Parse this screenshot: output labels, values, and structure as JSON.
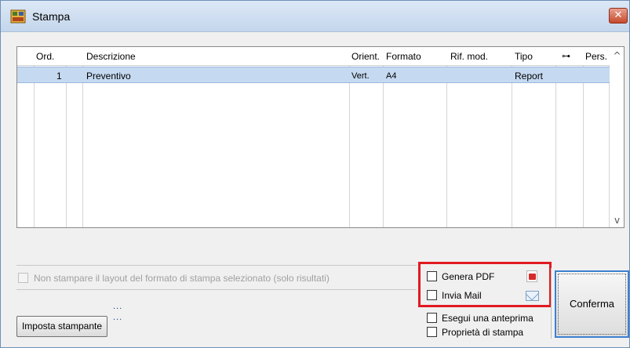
{
  "window": {
    "title": "Stampa",
    "close_glyph": "✕",
    "icon": "app-icon"
  },
  "grid": {
    "columns": [
      "Ord.",
      "Descrizione",
      "Orient.",
      "Formato",
      "Rif. mod.",
      "Tipo",
      "⊶",
      "Pers."
    ],
    "rows": [
      {
        "ord": "1",
        "descrizione": "Preventivo",
        "orient": "Vert.",
        "formato": "A4",
        "rif_mod": "",
        "tipo": "Report",
        "key": "",
        "pers": ""
      }
    ],
    "scroll_up": "^",
    "scroll_down": "v",
    "selected_row_color": "#c5d9f1"
  },
  "options": {
    "no_layout_label": "Non stampare il layout del formato di stampa selezionato (solo risultati)",
    "genera_pdf_label": "Genera PDF",
    "invia_mail_label": "Invia Mail",
    "anteprima_label": "Esegui una anteprima",
    "proprieta_label": "Proprietà di stampa"
  },
  "printer": {
    "dots_1": "...",
    "dots_2": "...",
    "imposta_label": "Imposta stampante"
  },
  "actions": {
    "conferma_label": "Conferma"
  },
  "colors": {
    "highlight": "#e11a22",
    "focus_border": "#3c7fd1"
  }
}
